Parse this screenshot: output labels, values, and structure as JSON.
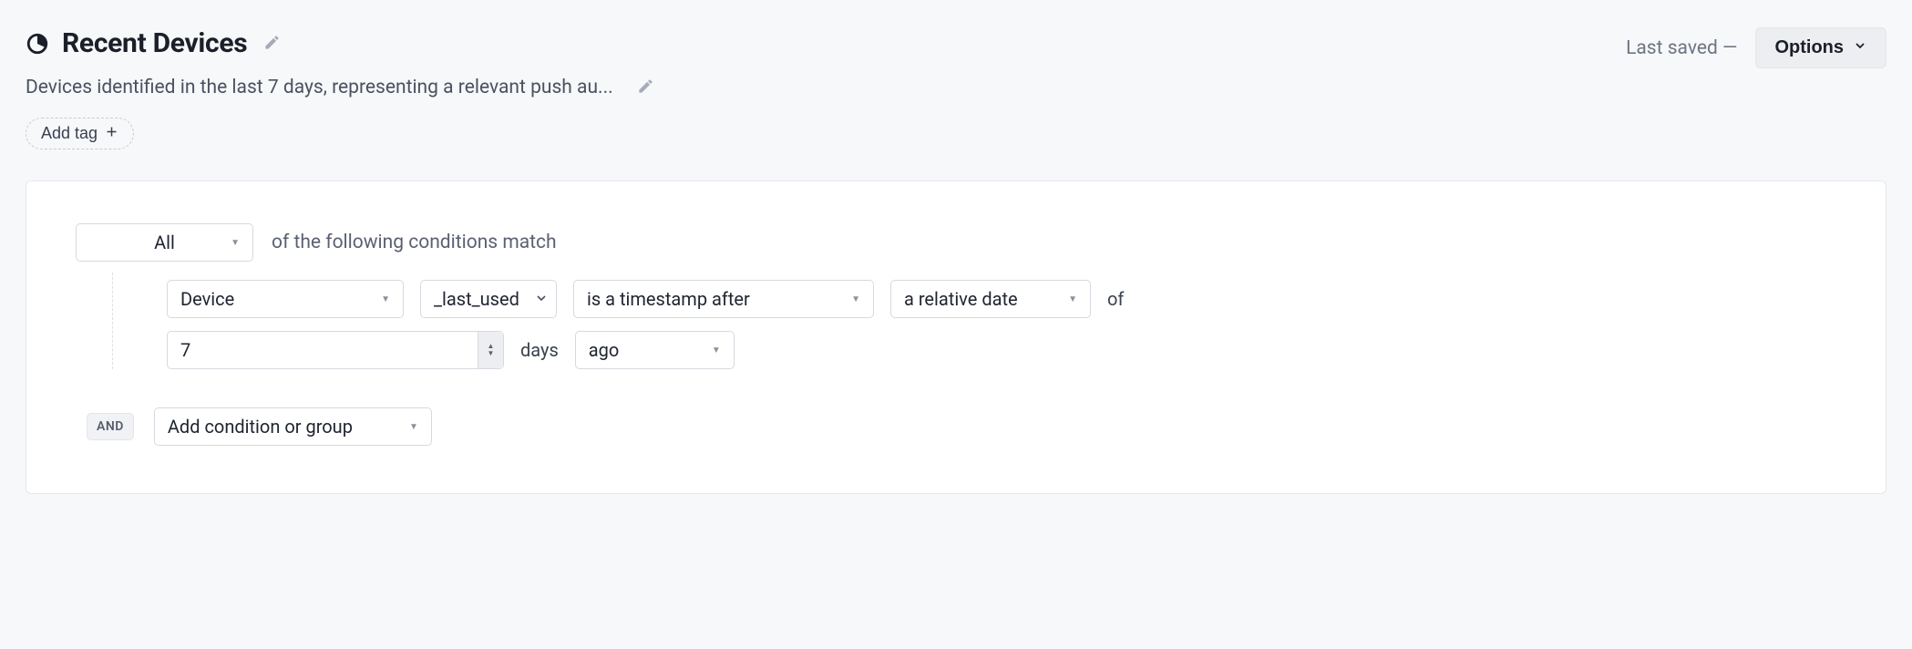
{
  "header": {
    "title": "Recent Devices",
    "description": "Devices identified in the last 7 days, representing a relevant push au...",
    "add_tag_label": "Add tag",
    "last_saved": "Last saved —",
    "options_label": "Options"
  },
  "builder": {
    "match_mode": "All",
    "match_text": "of the following conditions match",
    "condition": {
      "attribute": "Device",
      "field": "_last_used",
      "operator": "is a timestamp after",
      "relative_mode": "a relative date",
      "of_label": "of",
      "value": "7",
      "unit_label": "days",
      "direction": "ago"
    },
    "footer": {
      "and_label": "AND",
      "add_condition_label": "Add condition or group"
    }
  }
}
